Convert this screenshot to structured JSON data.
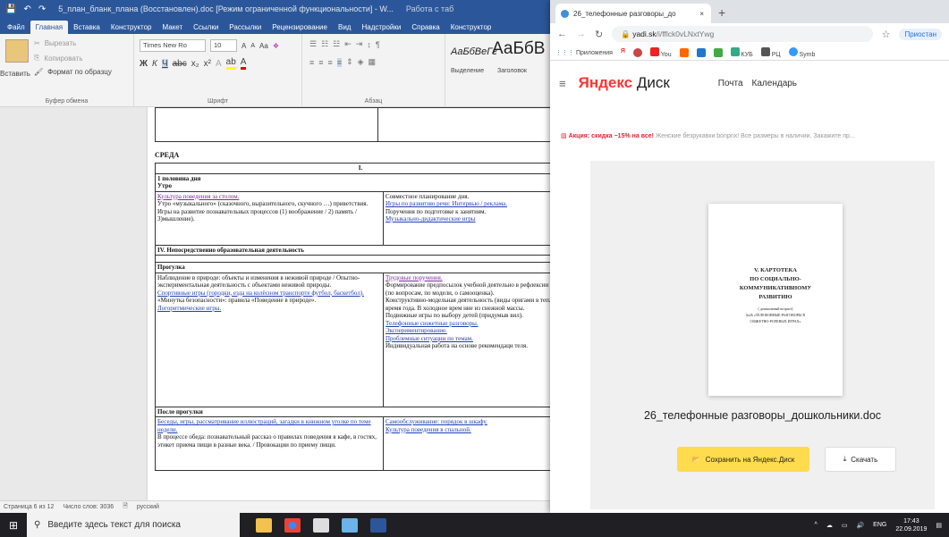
{
  "word": {
    "title": "5_план_бланк_плана (Восстановлен).doc [Режим ограниченной функциональности] - W...",
    "title_tab": "Работа с таб",
    "tabs": [
      "Файл",
      "Главная",
      "Вставка",
      "Конструктор",
      "Макет",
      "Ссылки",
      "Рассылки",
      "Рецензирование",
      "Вид",
      "Надстройки",
      "Справка",
      "Конструктор"
    ],
    "ribbon": {
      "paste": "Вставить",
      "cut": "Вырезать",
      "copy": "Копировать",
      "format_painter": "Формат по образцу",
      "clipboard_cap": "Буфер обмена",
      "font_name": "Times New Ro",
      "font_size": "10",
      "font_cap": "Шрифт",
      "para_cap": "Абзац",
      "style_sample1": "АаБбВеГг",
      "style_sample2": "АаБбВ",
      "style1": "Выделение",
      "style2": "Заголовок"
    },
    "doc": {
      "day": "СРЕДА",
      "col_num": "I.",
      "half_day": "1 половина дня",
      "morning": "Утро",
      "m_left": [
        "Культура поведения за столом.",
        "Утро «музыкального» (сказочного, выразительного, скучного …) приветствия.",
        "Игры на развитие познавательных процессов (1) воображение / 2) память / 3)мышление)."
      ],
      "m_right": [
        "Совместное планирование дня.",
        "Игры по развитию речи: Интервью / реклама.",
        "Поручения по подготовке к занятиям.",
        "Музыкально-дидактические игры"
      ],
      "section4": "IV. Непосредственно образовательная деятельность",
      "walk": "Прогулка",
      "w_left": [
        "Наблюдение в природе: объекты и изменения в неживой природе / Опытно-экспериментальная деятельность с объектами неживой природы.",
        "Спортивные игры (городки, езда на колёсном транспорте футбол, баскетбол).",
        "«Минутка безопасности»: правила «Поведение в природе».",
        "Логоритмические игры."
      ],
      "w_right": [
        "Трудовые поручения.",
        "Формирование предпосылок учебной деятельно в рефлексии НОД (по вопросам, по модели, о самооценка).",
        "Конструктивно-модельная деятельность (виды оригами в теплое время года. В холодное врем ние из снежной массы.",
        "Подвижные игры по выбору детей (придумыв вил).",
        "Телефонные сюжетные разговоры.",
        "Экспериментирование.",
        "Проблемные ситуации по темам.",
        "Индивидуальная работа на основе рекомендаци теля."
      ],
      "after_walk": "После прогулки",
      "a_left": [
        "Беседы, игры, рассматривание иллюстраций, загадки в книжном уголке по теме недели.",
        "В процессе обеда: познавательный рассказ о правилах поведения в кафе, в гостях, этикет приема пищи в разные века. / Провокации по приему пищи."
      ],
      "a_right": [
        "Самообслуживание: порядок в шкафу.",
        "Культура поведения в спальной."
      ]
    },
    "status": {
      "page": "Страница 6 из 12",
      "words": "Число слов: 3036",
      "lang": "русский"
    }
  },
  "chrome": {
    "tab_title": "26_телефонные разговоры_до",
    "url_host": "yadi.sk",
    "url_path": "/i/fflck0vLNxtYwg",
    "profile": "Приостан",
    "bookmarks": [
      "Приложения",
      "You",
      "КУБ",
      "РЦ",
      "Symb"
    ],
    "disk": {
      "logo_y": "Яндекс",
      "logo_rest": "Диск",
      "nav": [
        "Почта",
        "Календарь"
      ],
      "promo_hl": "Акция: скидка −15% на все!",
      "promo_rest": "Женские безрукавки bonprix! Все размеры в наличии. Закажите пр...",
      "thumb_title": [
        "V. КАРТОТЕКА",
        "ПО СОЦИАЛЬНО-",
        "КОММУНИКАТИВНОМУ",
        "РАЗВИТИЮ"
      ],
      "thumb_sub": [
        "( дошкольный возраст)",
        "№26 «ТЕЛЕФОННЫЕ РАЗГОВОРЫ В",
        "СЮЖЕТНО-РОЛЕВЫХ ИГРАХ»"
      ],
      "filename": "26_телефонные разговоры_дошкольники.doc",
      "save": "Сохранить на Яндекс.Диск",
      "download": "Скачать"
    }
  },
  "taskbar": {
    "search_placeholder": "Введите здесь текст для поиска",
    "lang": "ENG",
    "time": "17:43",
    "date": "22.09.2019"
  },
  "colors": {
    "word_blue": "#2b579a",
    "yandex_yellow": "#ffdb4d",
    "link_blue": "#1f3fb5",
    "link_visited": "#7a2b9b"
  }
}
